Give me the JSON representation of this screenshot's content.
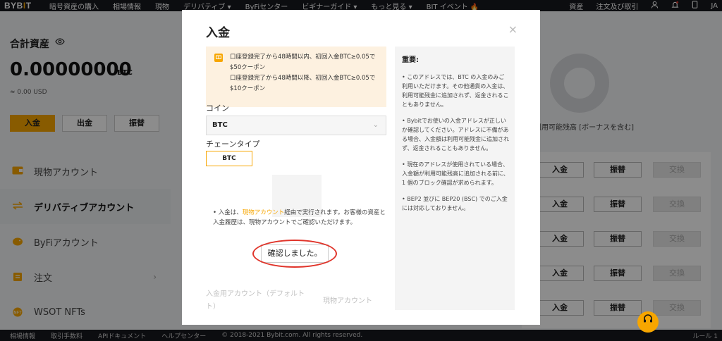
{
  "nav": {
    "logo_main": "BYB",
    "logo_dot": "I",
    "logo_tail": "T",
    "items": [
      "暗号資産の購入",
      "相場情報",
      "現物",
      "デリバティブ ▾",
      "ByFiセンター",
      "ビギナーガイド ▾",
      "もっと見る ▾",
      "BIT イベント 🔥"
    ],
    "right_items": [
      "資産",
      "注文及び取引"
    ],
    "lang": "JA"
  },
  "assets": {
    "title": "合計資産",
    "balance": "0.00000000",
    "unit": "BTC",
    "usd": "≈ 0.00 USD",
    "buttons": [
      "入金",
      "出金",
      "振替"
    ]
  },
  "side_menu": [
    {
      "label": "現物アカウント"
    },
    {
      "label": "デリバティブアカウント"
    },
    {
      "label": "ByFiアカウント"
    },
    {
      "label": "注文"
    },
    {
      "label": "WSOT NFTs"
    }
  ],
  "right_side": {
    "label": "利用可能残高 [ボーナスを含む]",
    "btn_deposit": "入金",
    "btn_transfer": "振替",
    "btn_exchange": "交換"
  },
  "footer": {
    "items": [
      "相場情報",
      "取引手数料",
      "APIドキュメント",
      "ヘルプセンター"
    ],
    "copyright": "© 2018-2021 Bybit.com. All rights reserved.",
    "right": "ルール 1"
  },
  "modal": {
    "title": "入金",
    "close": "×",
    "notice": {
      "line1": "口座登録完了から48時間以内、初回入金BTC≥0.05で",
      "line2": "$50クーポン",
      "line3": "口座登録完了から48時間以降、初回入金BTC≥0.05で",
      "line4": "$10クーポン"
    },
    "coin_label": "コイン",
    "coin_value": "BTC",
    "chain_label": "チェーンタイプ",
    "chain_value": "BTC",
    "note_prefix": "• 入金は、",
    "note_link": "現物アカウント",
    "note_suffix": "経由で実行されます。お客様の資産と入金履歴は、現物アカウントでご確認いただけます。",
    "confirm": "確認しました。",
    "ghost_label_1": "入金用アカウント（デフォルト",
    "ghost_label_2": "ト）",
    "ghost_right": "現物アカウント",
    "important": {
      "title": "重要:",
      "items": [
        "• このアドレスでは、BTC の入金のみご利用いただけます。その他通貨の入金は、利用可能残金に追加されず、返金されることもありません。",
        "• Bybitでお使いの入金アドレスが正しいか確認してください。アドレスに不備がある場合、入金額は利用可能残金に追加されず、返金されることもありません。",
        "• 現在のアドレスが使用されている場合、入金額が利用可能残高に追加される前に、1 個のブロック確認が求められます。",
        "• BEP2 並びに BEP20 (BSC) でのご入金には対応しておりません。"
      ]
    }
  }
}
